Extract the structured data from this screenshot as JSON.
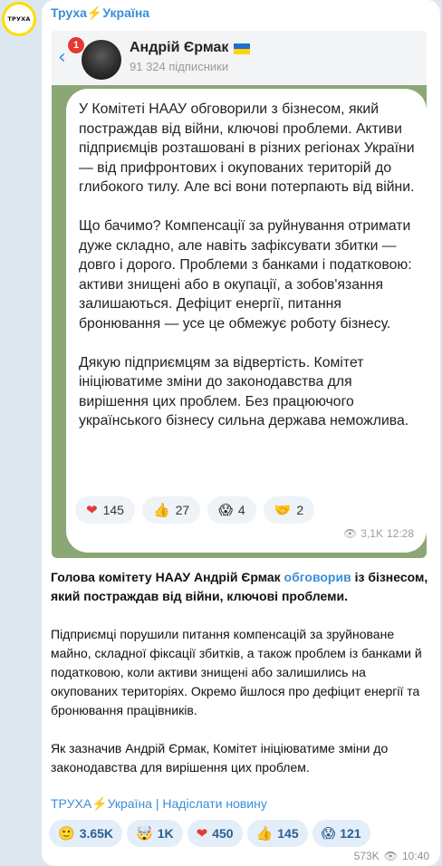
{
  "channel": {
    "name_prefix": "Труха",
    "name_bolt": "⚡",
    "name_suffix": "Україна",
    "avatar_text": "ТРУХА"
  },
  "embedded": {
    "back_icon": "chevron-left-icon",
    "notification_count": "1",
    "author_name": "Андрій Єрмак",
    "subscribers": "91 324 підписники",
    "paragraphs": [
      "У Комітеті НААУ обговорили з бізнесом, який постраждав від війни, ключові проблеми. Активи підприємців розташовані в різних регіонах України — від прифронтових і окупованих територій до глибокого тилу. Але всі вони потерпають від війни.",
      "Що бачимо? Компенсації за руйнування отримати дуже складно, але навіть зафіксувати збитки — довго і дорого. Проблеми з банками і податковою: активи знищені або в окупації, а зобов'язання залишаються. Дефіцит енергії, питання бронювання — усе це обмежує роботу бізнесу.",
      "Дякую підприємцям за відвертість. Комітет ініціюватиме зміни до законодавства для вирішення цих проблем. Без працюючого українського бізнесу сильна держава неможлива."
    ],
    "reactions": [
      {
        "icon": "❤",
        "count": "145"
      },
      {
        "icon": "👍",
        "count": "27"
      },
      {
        "icon": "😱",
        "count": "4"
      },
      {
        "icon": "🤝",
        "count": "2"
      }
    ],
    "views": "3,1K",
    "time": "12:28"
  },
  "caption": {
    "lead_1": "Голова комітету НААУ Андрій Єрмак ",
    "lead_link": "обговорив",
    "lead_2": " із бізнесом, який постраждав від війни, ключові проблеми.",
    "p2": "Підприємці порушили питання компенсацій за зруйноване майно, складної фіксації збитків, а також проблем із банками й податковою, коли активи знищені або залишились на окупованих територіях. Окремо йшлося про дефіцит енергії та бронювання працівників.",
    "p3": "Як зазначив Андрій Єрмак, Комітет ініціюватиме зміни до законодавства для вирішення цих проблем."
  },
  "signature": {
    "channel": "ТРУХА",
    "bolt": "⚡",
    "country": "Україна",
    "separator": " | ",
    "submit": "Надіслати новину"
  },
  "bottom_reactions": [
    {
      "icon": "🙂",
      "count": "3.65K"
    },
    {
      "icon": "🤯",
      "count": "1K"
    },
    {
      "icon": "❤",
      "count": "450"
    },
    {
      "icon": "👍",
      "count": "145"
    },
    {
      "icon": "😱",
      "count": "121"
    }
  ],
  "meta": {
    "views": "573K",
    "time": "10:40"
  }
}
